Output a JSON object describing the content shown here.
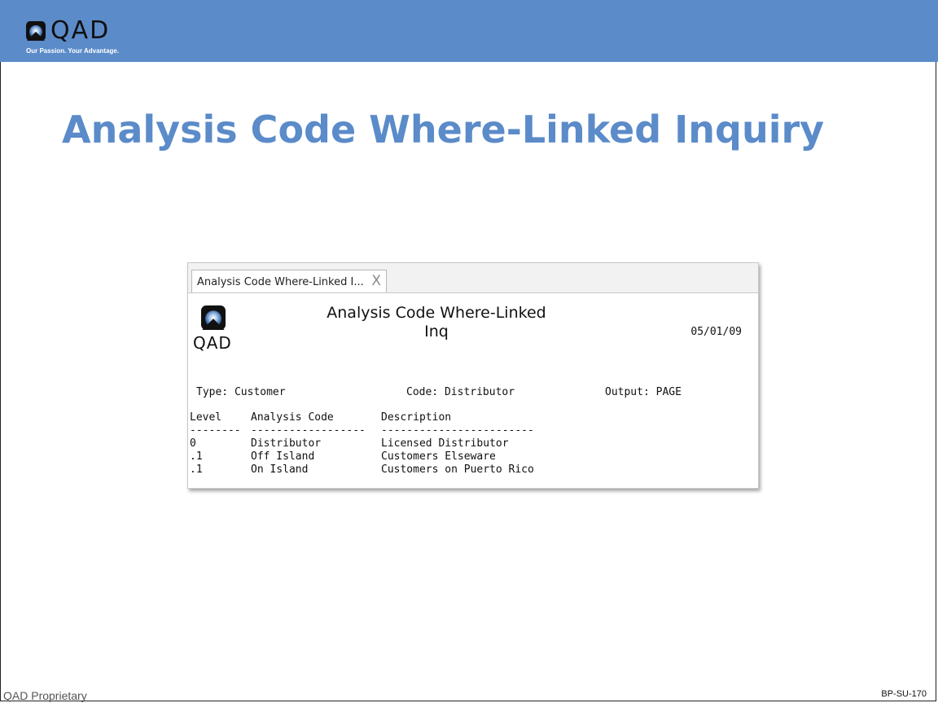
{
  "brand": {
    "name": "QAD",
    "tagline": "Our Passion. Your Advantage."
  },
  "slide": {
    "title": "Analysis Code Where-Linked Inquiry",
    "footer_left": "QAD Proprietary",
    "footer_right": "BP-SU-170"
  },
  "window": {
    "tab_label": "Analysis Code Where-Linked I...",
    "tab_close": "X",
    "logo_text": "QAD",
    "report_title_line1": "Analysis Code Where-Linked",
    "report_title_line2": "Inq",
    "report_date": "05/01/09",
    "criteria": {
      "type": "Type: Customer",
      "code": "Code: Distributor",
      "output": "Output: PAGE"
    },
    "table": {
      "headers": [
        "Level",
        "Analysis Code",
        "Description"
      ],
      "separators": [
        "--------",
        "------------------",
        "------------------------"
      ],
      "rows": [
        [
          "0",
          "Distributor",
          "Licensed Distributor"
        ],
        [
          ".1",
          "Off Island",
          "Customers Elseware"
        ],
        [
          ".1",
          "On Island",
          "Customers on Puerto Rico"
        ]
      ]
    }
  },
  "colors": {
    "header_bar": "#5b8bc9",
    "title": "#5b8bc9"
  }
}
